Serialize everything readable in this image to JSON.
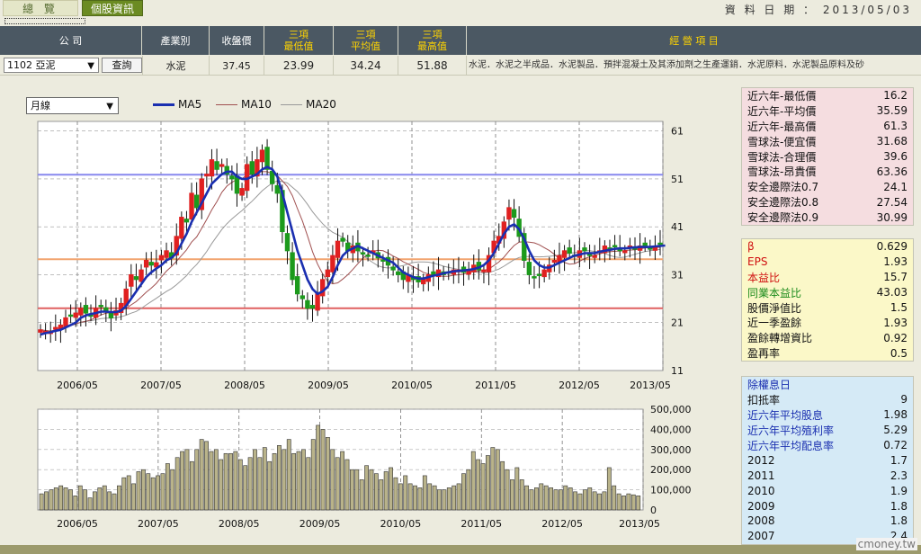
{
  "tabs": {
    "overview": "總 覽",
    "stock_info": "個股資訊"
  },
  "data_date": "資 料 日 期 ： 2013/05/03",
  "header": {
    "company": "公 司",
    "industry": "產業別",
    "close": "收盤價",
    "low3": [
      "三項",
      "最低值"
    ],
    "avg3": [
      "三項",
      "平均值"
    ],
    "high3": [
      "三項",
      "最高值"
    ],
    "business": "經 營 項 目"
  },
  "row": {
    "stock": "1102 亞泥",
    "query": "查詢",
    "industry": "水泥",
    "close": "37.45",
    "low3": "23.99",
    "avg3": "34.24",
    "high3": "51.88",
    "business": "水泥．水泥之半成品．水泥製品．預拌混凝土及其添加劑之生產運銷．水泥原料．水泥製品原料及砂"
  },
  "period": "月線",
  "legend": [
    {
      "name": "MA5",
      "color": "#1a2fb0"
    },
    {
      "name": "MA10",
      "color": "#a05050"
    },
    {
      "name": "MA20",
      "color": "#999999"
    }
  ],
  "panel_valuation": [
    {
      "label": "近六年-最低價",
      "value": "16.2"
    },
    {
      "label": "近六年-平均價",
      "value": "35.59"
    },
    {
      "label": "近六年-最高價",
      "value": "61.3"
    },
    {
      "label": "雪球法-便宜價",
      "value": "31.68"
    },
    {
      "label": "雪球法-合理價",
      "value": "39.6"
    },
    {
      "label": "雪球法-昂貴價",
      "value": "63.36"
    },
    {
      "label": "安全邊際法0.7",
      "value": "24.1"
    },
    {
      "label": "安全邊際法0.8",
      "value": "27.54"
    },
    {
      "label": "安全邊際法0.9",
      "value": "30.99"
    }
  ],
  "panel_ratios": [
    {
      "label": "β",
      "value": "0.629",
      "color": "#d01010"
    },
    {
      "label": " EPS",
      "value": "1.93",
      "color": "#d01010"
    },
    {
      "label": "本益比",
      "value": "15.7",
      "color": "#d01010"
    },
    {
      "label": "同業本益比",
      "value": "43.03",
      "color": "#1a8a1a"
    },
    {
      "label": "股價淨值比",
      "value": "1.5",
      "color": "#111111"
    },
    {
      "label": "近一季盈餘",
      "value": "1.93",
      "color": "#111111"
    },
    {
      "label": "盈餘轉增資比",
      "value": "0.92",
      "color": "#111111"
    },
    {
      "label": "盈再率",
      "value": "0.5",
      "color": "#111111"
    }
  ],
  "panel_dividend": [
    {
      "label": "除權息日",
      "value": "",
      "color": "#1a2fb0"
    },
    {
      "label": "扣抵率",
      "value": "9",
      "color": "#111111"
    },
    {
      "label": "近六年平均股息",
      "value": "1.98",
      "color": "#1a2fb0"
    },
    {
      "label": "近六年平均殖利率",
      "value": "5.29",
      "color": "#1a2fb0"
    },
    {
      "label": "近六年平均配息率",
      "value": "0.72",
      "color": "#1a2fb0"
    },
    {
      "label": "2012",
      "value": "1.7",
      "color": "#111111"
    },
    {
      "label": "2011",
      "value": "2.3",
      "color": "#111111"
    },
    {
      "label": "2010",
      "value": "1.9",
      "color": "#111111"
    },
    {
      "label": "2009",
      "value": "1.8",
      "color": "#111111"
    },
    {
      "label": "2008",
      "value": "1.8",
      "color": "#111111"
    },
    {
      "label": "2007",
      "value": "2.4",
      "color": "#111111"
    }
  ],
  "watermark": "cmoney.tw",
  "chart_data": [
    {
      "type": "candlestick",
      "x_tick_labels": [
        "2006/05",
        "2007/05",
        "2008/05",
        "2009/05",
        "2010/05",
        "2011/05",
        "2012/05",
        "2013/05"
      ],
      "y_tick_labels": [
        "61",
        "51",
        "41",
        "31",
        "21",
        "11"
      ],
      "ylim": [
        11,
        63
      ],
      "up_color": "#e02020",
      "down_color": "#1c9a1c",
      "hlines": [
        {
          "value": 51.88,
          "color": "#8888ee"
        },
        {
          "value": 34.24,
          "color": "#f2a36e"
        },
        {
          "value": 23.99,
          "color": "#e06060"
        }
      ],
      "series_close": [
        19.5,
        19.2,
        19,
        20,
        20.5,
        22,
        22.5,
        23,
        24,
        23,
        22.5,
        24,
        24.5,
        23.5,
        22,
        23.5,
        25,
        28,
        31,
        30,
        32,
        34,
        33,
        33.5,
        35,
        36,
        34.5,
        39,
        43,
        42,
        48,
        45,
        51,
        52,
        55,
        53,
        54,
        52,
        51,
        48,
        49,
        54,
        52,
        55,
        57,
        53,
        50,
        48,
        40,
        36,
        30,
        27,
        26,
        24,
        24,
        27,
        30,
        32,
        35,
        38,
        38,
        36,
        37,
        36,
        35.5,
        35,
        36,
        34.5,
        34,
        33,
        32,
        31,
        30,
        31,
        30,
        29.5,
        30,
        31,
        31,
        32,
        31,
        31.5,
        32,
        32,
        31.5,
        32,
        33,
        32,
        32,
        35,
        38,
        39,
        42,
        45,
        43,
        39,
        34,
        31,
        30.5,
        31,
        32,
        33,
        34,
        35,
        36,
        35.5,
        35,
        36,
        36,
        35,
        35,
        36,
        37,
        36.5,
        37,
        36,
        36,
        37,
        36.5,
        37,
        37,
        36.5,
        37,
        37.45
      ],
      "series_ma5": [
        18.5,
        18.8,
        19,
        19.3,
        19.5,
        20,
        20.5,
        21,
        22,
        22.5,
        22.8,
        23,
        23.3,
        23.3,
        23.2,
        23.2,
        23.5,
        24.5,
        26,
        27.5,
        29,
        30.5,
        31.5,
        32.3,
        33,
        34,
        34.5,
        35.5,
        37.5,
        39.5,
        42,
        44,
        46,
        48,
        50,
        51,
        52,
        52.5,
        52.5,
        51.5,
        51,
        51,
        51.5,
        52,
        53,
        53.5,
        53,
        51.5,
        48,
        44,
        40,
        36,
        33,
        30,
        28,
        27,
        27.5,
        28.5,
        30.5,
        33,
        35,
        36,
        36.5,
        37,
        36.5,
        36,
        35.5,
        35,
        34.5,
        34,
        33.5,
        32.5,
        31.5,
        31,
        30.5,
        30.2,
        30.2,
        30.5,
        30.8,
        31,
        31.3,
        31.5,
        31.7,
        31.8,
        31.9,
        32,
        32.2,
        32.5,
        33,
        34,
        35.5,
        37.5,
        39.5,
        41,
        41.5,
        40.5,
        38.5,
        36,
        34,
        33,
        32.5,
        32.5,
        33,
        33.5,
        34,
        34.5,
        35,
        35.2,
        35.5,
        35.5,
        35.5,
        35.8,
        36,
        36.2,
        36.4,
        36.5,
        36.5,
        36.6,
        36.7,
        36.8,
        36.8,
        36.8,
        36.9,
        37,
        37.1
      ],
      "volume_ylim": [
        0,
        500000
      ],
      "volume_tick_labels": [
        "500,000",
        "400,000",
        "300,000",
        "200,000",
        "100,000",
        "0"
      ],
      "volume": [
        80000,
        90000,
        100000,
        110000,
        120000,
        110000,
        100000,
        70000,
        120000,
        100000,
        60000,
        90000,
        110000,
        120000,
        90000,
        80000,
        120000,
        160000,
        170000,
        130000,
        190000,
        200000,
        180000,
        160000,
        170000,
        180000,
        230000,
        200000,
        260000,
        290000,
        300000,
        240000,
        300000,
        350000,
        340000,
        290000,
        300000,
        250000,
        280000,
        280000,
        290000,
        250000,
        220000,
        260000,
        300000,
        260000,
        310000,
        240000,
        280000,
        320000,
        300000,
        350000,
        280000,
        290000,
        300000,
        260000,
        350000,
        420000,
        400000,
        360000,
        300000,
        260000,
        290000,
        250000,
        200000,
        200000,
        150000,
        220000,
        200000,
        180000,
        150000,
        190000,
        210000,
        160000,
        130000,
        170000,
        130000,
        120000,
        110000,
        170000,
        130000,
        120000,
        100000,
        100000,
        110000,
        120000,
        130000,
        180000,
        200000,
        290000,
        250000,
        230000,
        270000,
        310000,
        300000,
        240000,
        200000,
        150000,
        210000,
        150000,
        120000,
        100000,
        110000,
        130000,
        120000,
        110000,
        100000,
        100000,
        120000,
        110000,
        90000,
        80000,
        100000,
        110000,
        90000,
        80000,
        90000,
        210000,
        120000,
        80000,
        70000,
        80000,
        75000,
        70000
      ]
    }
  ]
}
